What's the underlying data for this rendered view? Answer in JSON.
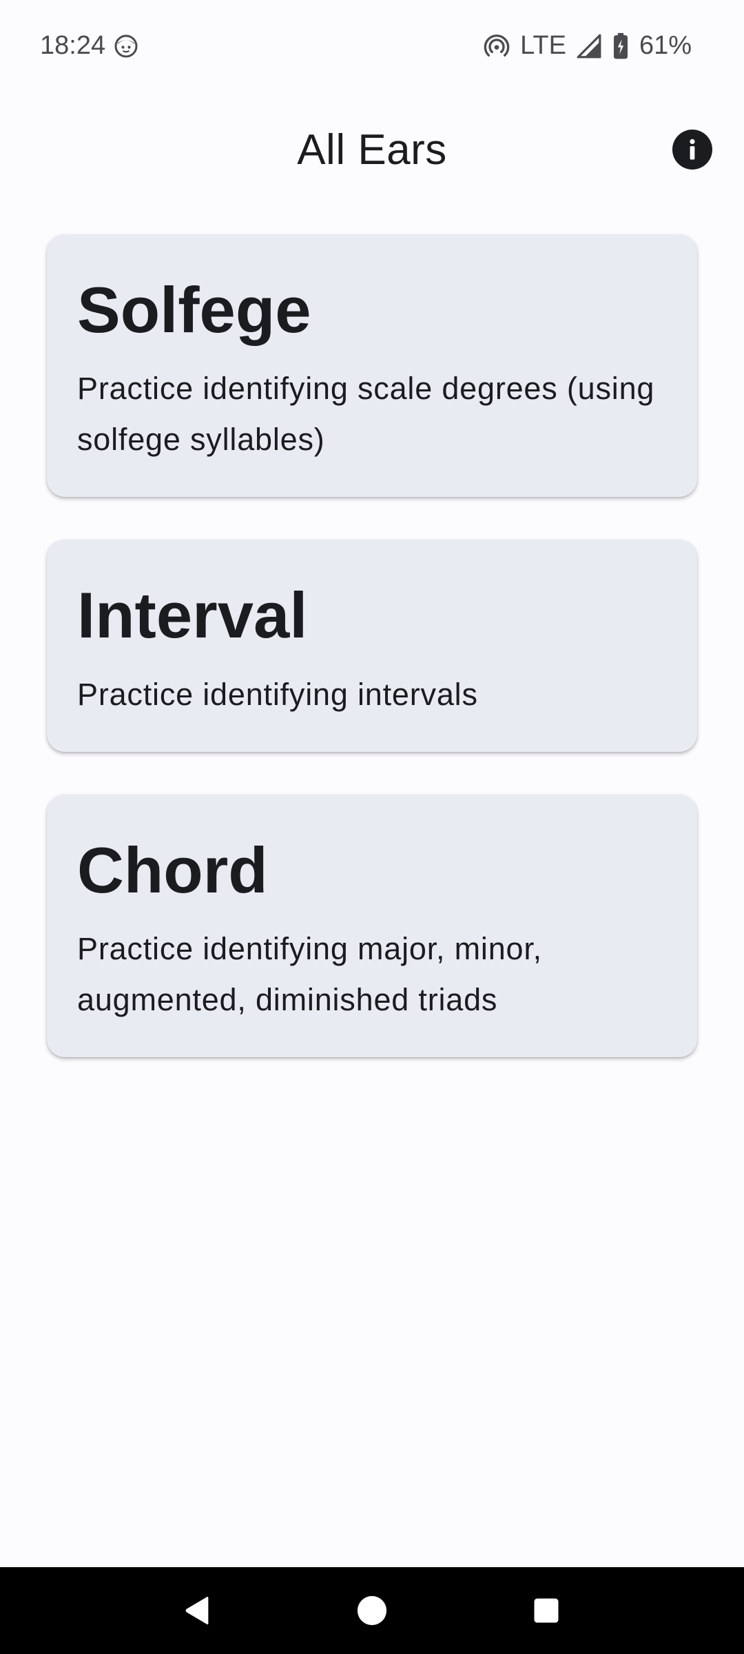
{
  "status_bar": {
    "time": "18:24",
    "network": "LTE",
    "battery": "61%",
    "icons": [
      "face-icon",
      "hotspot-icon",
      "signal-icon",
      "battery-charging-icon"
    ]
  },
  "app_bar": {
    "title": "All Ears",
    "info_icon": "info-icon"
  },
  "cards": [
    {
      "title": "Solfege",
      "description": "Practice identifying scale degrees (using solfege syllables)"
    },
    {
      "title": "Interval",
      "description": "Practice identifying intervals"
    },
    {
      "title": "Chord",
      "description": "Practice identifying major, minor, augmented, diminished triads"
    }
  ],
  "nav_bar": {
    "buttons": [
      "back-icon",
      "home-icon",
      "recents-icon"
    ]
  },
  "colors": {
    "background": "#fcfbfe",
    "card": "#e9ebf2",
    "text": "#1b1c20",
    "nav_bar": "#000000"
  }
}
